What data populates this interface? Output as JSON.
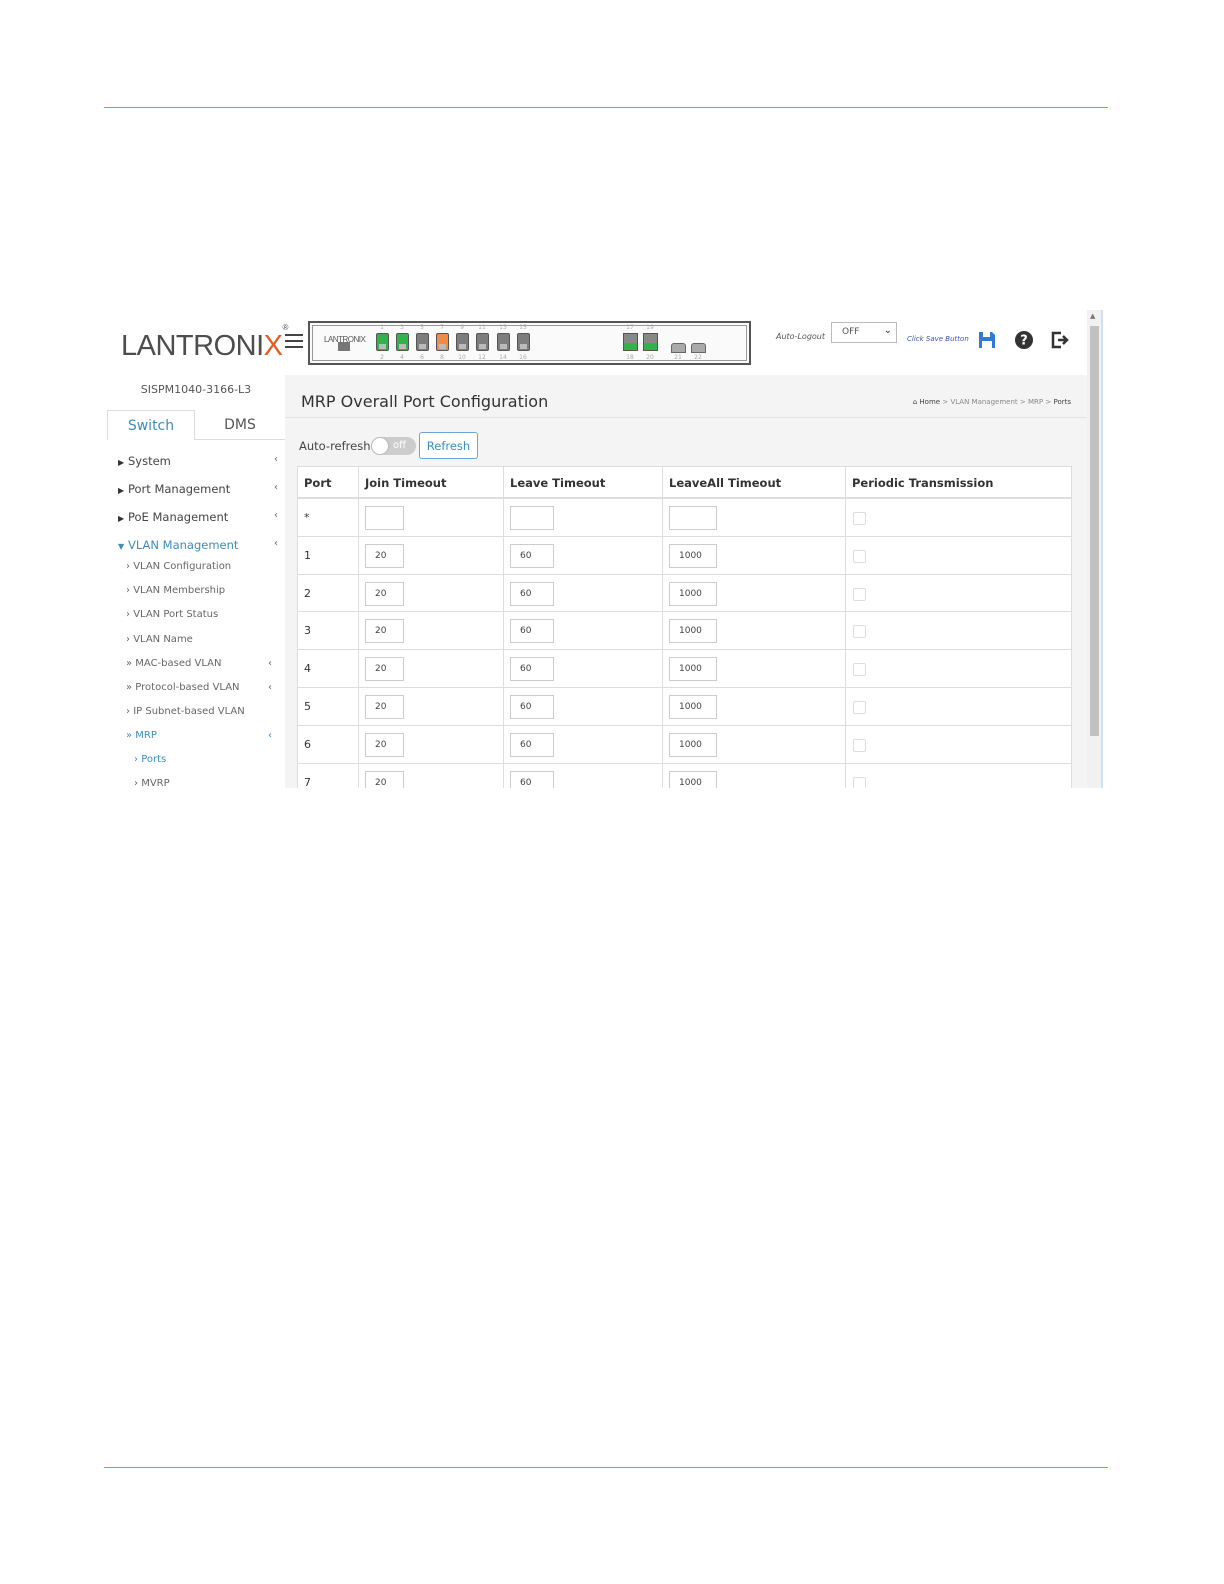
{
  "header": {
    "logo_main": "LANTRONI",
    "logo_x": "X",
    "logo_mark": "®",
    "panel_logo": "LANTRONIX",
    "ports_top": [
      "1",
      "3",
      "5",
      "7",
      "9",
      "11",
      "13",
      "15",
      "17",
      "19"
    ],
    "ports_bottom": [
      "2",
      "4",
      "6",
      "8",
      "10",
      "12",
      "14",
      "16",
      "18",
      "20",
      "21",
      "22"
    ],
    "auto_logout_label": "Auto-Logout",
    "auto_logout_value": "OFF",
    "save_hint": "Click Save Button",
    "icons": [
      "menu-icon",
      "save-icon",
      "help-icon",
      "logout-icon"
    ]
  },
  "sidebar": {
    "device_name": "SISPM1040-3166-L3",
    "tabs": [
      "Switch",
      "DMS"
    ],
    "items": [
      {
        "label": "System"
      },
      {
        "label": "Port Management"
      },
      {
        "label": "PoE Management"
      },
      {
        "label": "VLAN Management"
      }
    ],
    "sub_items": [
      {
        "label": "VLAN Configuration"
      },
      {
        "label": "VLAN Membership"
      },
      {
        "label": "VLAN Port Status"
      },
      {
        "label": "VLAN Name"
      },
      {
        "label": "MAC-based VLAN"
      },
      {
        "label": "Protocol-based VLAN"
      },
      {
        "label": "IP Subnet-based VLAN"
      },
      {
        "label": "MRP"
      }
    ],
    "mrp_items": [
      {
        "label": "Ports"
      },
      {
        "label": "MVRP"
      }
    ]
  },
  "main": {
    "title": "MRP Overall Port Configuration",
    "breadcrumb": {
      "home": "Home",
      "sep": ">",
      "level1": "VLAN Management",
      "level2": "MRP",
      "current": "Ports"
    },
    "auto_refresh_label": "Auto-refresh",
    "toggle_text": "off",
    "refresh_label": "Refresh",
    "columns": [
      "Port",
      "Join Timeout",
      "Leave Timeout",
      "LeaveAll Timeout",
      "Periodic Transmission"
    ],
    "rows": [
      {
        "port": "*",
        "join": "",
        "leave": "",
        "leaveall": ""
      },
      {
        "port": "1",
        "join": "20",
        "leave": "60",
        "leaveall": "1000"
      },
      {
        "port": "2",
        "join": "20",
        "leave": "60",
        "leaveall": "1000"
      },
      {
        "port": "3",
        "join": "20",
        "leave": "60",
        "leaveall": "1000"
      },
      {
        "port": "4",
        "join": "20",
        "leave": "60",
        "leaveall": "1000"
      },
      {
        "port": "5",
        "join": "20",
        "leave": "60",
        "leaveall": "1000"
      },
      {
        "port": "6",
        "join": "20",
        "leave": "60",
        "leaveall": "1000"
      },
      {
        "port": "7",
        "join": "20",
        "leave": "60",
        "leaveall": "1000"
      }
    ]
  },
  "colors": {
    "accent": "#3c8dbc",
    "rule": "#e0874a",
    "brand_x": "#e35b25",
    "port_green": "#2fb34a",
    "port_orange": "#f08a4b"
  }
}
